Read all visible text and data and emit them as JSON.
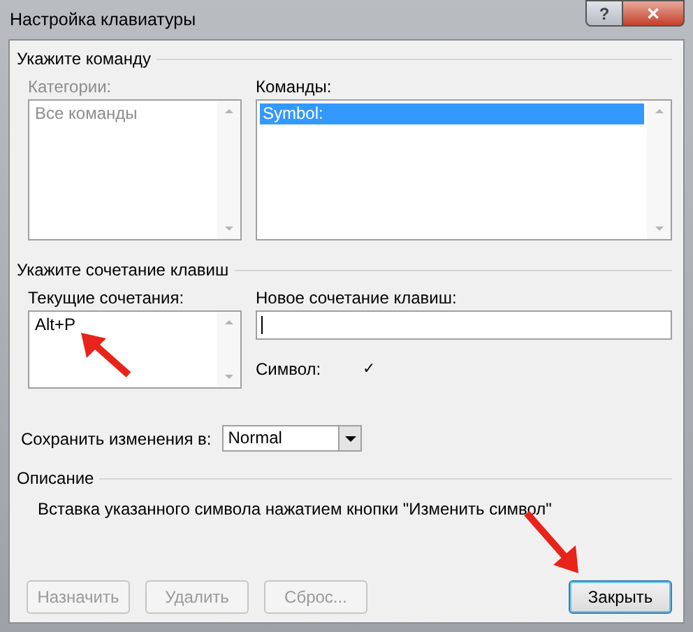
{
  "window": {
    "title": "Настройка клавиатуры",
    "help": "?",
    "close": "✕"
  },
  "command_group": {
    "title": "Укажите команду",
    "categories": {
      "label": "Категории:",
      "disabled": true,
      "items": [
        {
          "label": "Все команды",
          "selected": false
        }
      ]
    },
    "commands": {
      "label": "Команды:",
      "disabled": false,
      "items": [
        {
          "label": "Symbol:",
          "selected": true
        }
      ]
    }
  },
  "shortcut_group": {
    "title": "Укажите сочетание клавиш",
    "current": {
      "label": "Текущие сочетания:",
      "items": [
        "Alt+P"
      ]
    },
    "new_shortcut": {
      "label": "Новое сочетание клавиш:"
    },
    "symbol": {
      "label": "Символ:",
      "value": "✓"
    }
  },
  "save_in": {
    "label": "Сохранить изменения в:",
    "value": "Normal"
  },
  "description": {
    "title": "Описание",
    "text": "Вставка указанного символа нажатием кнопки \"Изменить символ\""
  },
  "buttons": [
    {
      "label": "Назначить",
      "disabled": true,
      "default": false
    },
    {
      "label": "Удалить",
      "disabled": true,
      "default": false
    },
    {
      "label": "Сброс...",
      "disabled": true,
      "default": false
    },
    {
      "label": "Закрыть",
      "disabled": false,
      "default": true
    }
  ]
}
